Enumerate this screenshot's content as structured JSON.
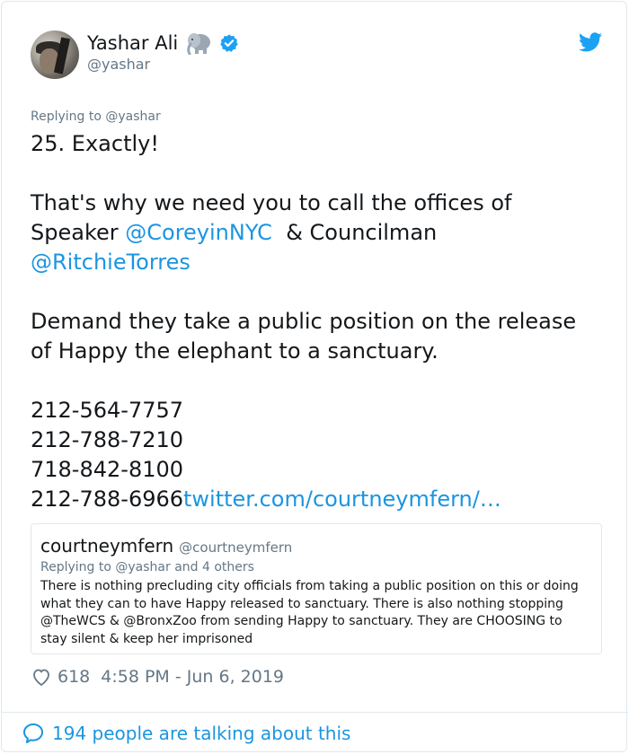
{
  "author": {
    "display_name": "Yashar Ali",
    "handle": "@yashar"
  },
  "icons": [
    "elephant-icon",
    "verified-icon",
    "twitter-bird-icon",
    "heart-icon",
    "speech-bubble-icon"
  ],
  "colors": {
    "link": "#1b95e0",
    "muted": "#657786",
    "text": "#14171a",
    "border": "#e1e8ed"
  },
  "tweet": {
    "replying_to": "Replying to @yashar",
    "line1": "25. Exactly!",
    "line2a": "That's why we need you to call the offices of",
    "line3_pre": "Speaker ",
    "mention1": "@CoreyinNYC",
    "line3_post": "  & Councilman",
    "mention2": "@RitchieTorres",
    "line4": "Demand they take a public position on the release of Happy the elephant to a sanctuary.",
    "phones": [
      "212-564-7757",
      "212-788-7210",
      "718-842-8100",
      "212-788-6966"
    ],
    "link": "twitter.com/courtneymfern/…"
  },
  "quote": {
    "name": "courtneymfern",
    "handle": "@courtneymfern",
    "replying_to": "Replying to @yashar and 4 others",
    "text": "There is nothing precluding city officials from taking a public position on this or doing what they can to have Happy released to sanctuary. There is also nothing stopping @TheWCS & @BronxZoo from sending Happy to sanctuary. They are CHOOSING to stay silent & keep her imprisoned"
  },
  "meta": {
    "likes": "618",
    "timestamp": "4:58 PM - Jun 6, 2019"
  },
  "footer": {
    "talking": "194 people are talking about this"
  }
}
